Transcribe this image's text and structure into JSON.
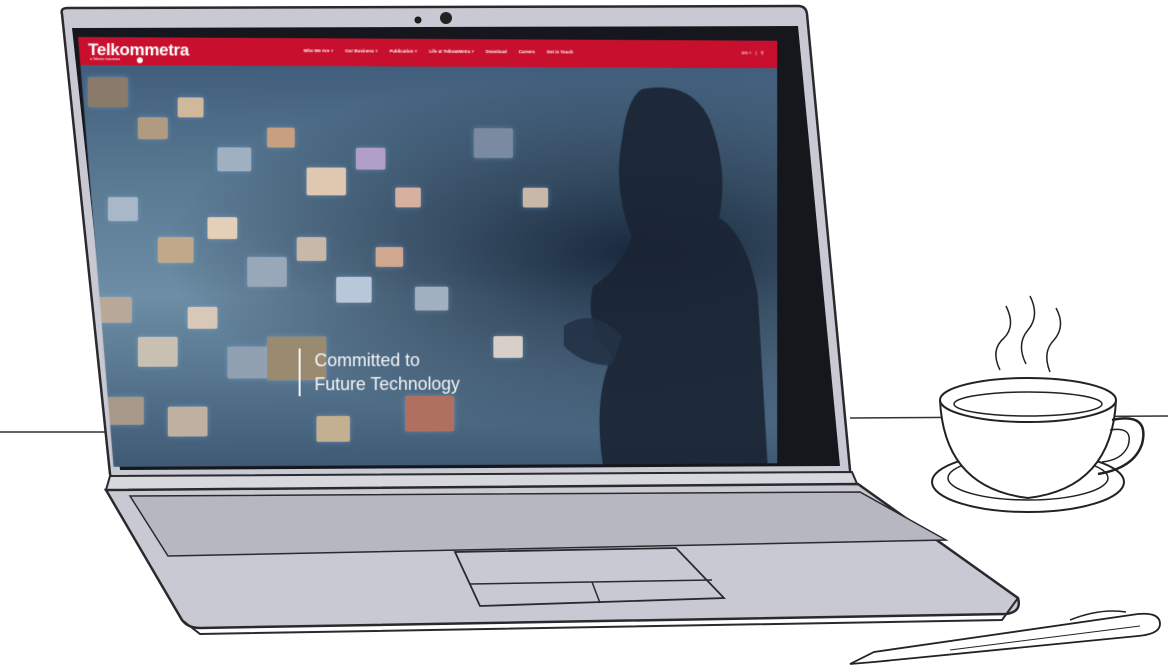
{
  "site": {
    "brand_part1": "Telkom",
    "brand_part2": "metra",
    "brand_tagline": "a Telkom Indonesia",
    "brand_color": "#c8102e"
  },
  "nav": {
    "items": [
      {
        "label": "Who We Are ˅"
      },
      {
        "label": "Our Business ˅"
      },
      {
        "label": "Publication ˅"
      },
      {
        "label": "Life at TelkomMetra ˅"
      },
      {
        "label": "Download"
      },
      {
        "label": "Careers"
      },
      {
        "label": "Get in Touch"
      }
    ],
    "language": "EN ˅",
    "search_icon": "search-icon"
  },
  "hero": {
    "line1": "Committed to",
    "line2": "Future Technology"
  }
}
